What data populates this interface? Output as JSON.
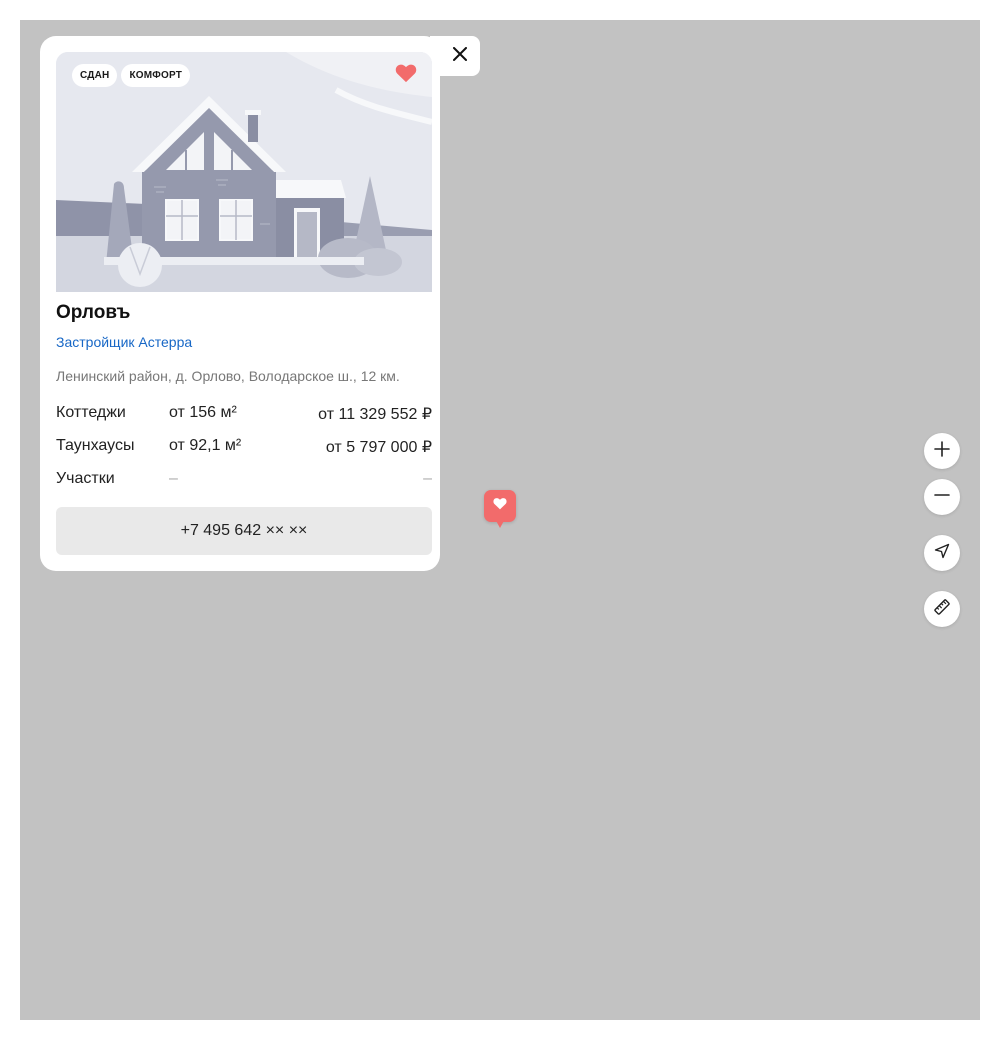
{
  "map": {
    "background": "#c2c2c2"
  },
  "card": {
    "badges": [
      "СДАН",
      "КОМФОРТ"
    ],
    "title": "Орловъ",
    "developer": "Застройщик Астерра",
    "address": "Ленинский район, д. Орлово, Володарское ш., 12 км.",
    "offers": [
      {
        "type": "Коттеджи",
        "area": "от 156 м²",
        "price": "от 11 329 552 ₽"
      },
      {
        "type": "Таунхаусы",
        "area": "от 92,1 м²",
        "price": "от 5 797 000 ₽"
      },
      {
        "type": "Участки",
        "area": "–",
        "price": "–"
      }
    ],
    "phone": "+7 495 642 ×× ××",
    "favorite_color": "#f26b6b",
    "link_color": "#1767c6"
  },
  "controls": {
    "icons": [
      "close-icon",
      "heart-icon",
      "plus-icon",
      "minus-icon",
      "navigation-arrow-icon",
      "ruler-icon"
    ]
  }
}
